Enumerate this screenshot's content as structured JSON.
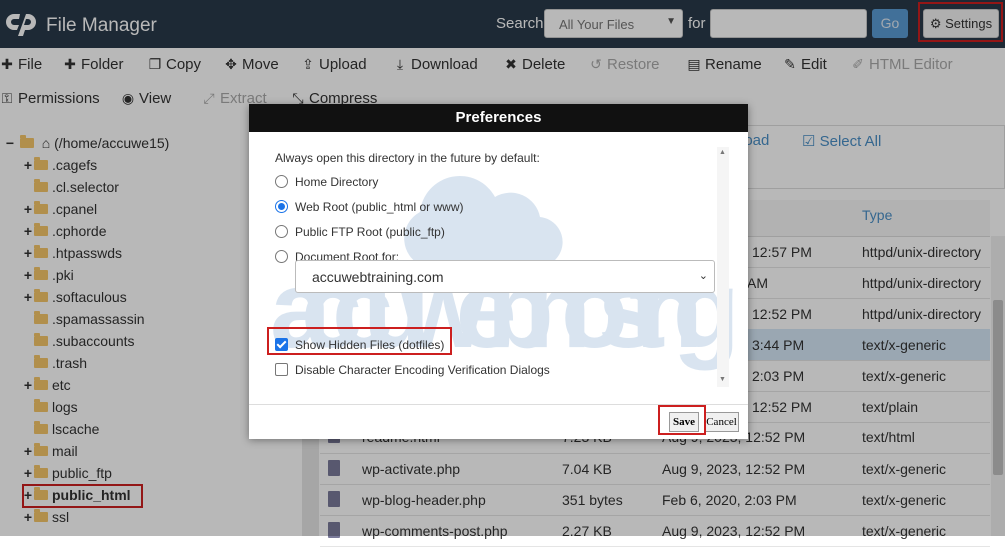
{
  "header": {
    "app_title": "File Manager",
    "search_label": "Search",
    "search_scope": "All Your Files",
    "for_label": "for",
    "search_value": "",
    "go_label": "Go",
    "settings_label": "Settings"
  },
  "toolbar": {
    "row1": [
      {
        "label": "File",
        "icon": "plus-icon",
        "disabled": false
      },
      {
        "label": "Folder",
        "icon": "plus-icon",
        "disabled": false
      },
      {
        "label": "Copy",
        "icon": "copy-icon",
        "disabled": false
      },
      {
        "label": "Move",
        "icon": "move-icon",
        "disabled": false
      },
      {
        "label": "Upload",
        "icon": "upload-icon",
        "disabled": false
      },
      {
        "label": "Download",
        "icon": "download-icon",
        "disabled": false
      },
      {
        "label": "Delete",
        "icon": "close-icon",
        "disabled": false
      },
      {
        "label": "Restore",
        "icon": "restore-icon",
        "disabled": true
      },
      {
        "label": "Rename",
        "icon": "document-icon",
        "disabled": false
      },
      {
        "label": "Edit",
        "icon": "pencil-icon",
        "disabled": false
      },
      {
        "label": "HTML Editor",
        "icon": "edit-square-icon",
        "disabled": true
      }
    ],
    "row2": [
      {
        "label": "Permissions",
        "icon": "key-icon",
        "disabled": false
      },
      {
        "label": "View",
        "icon": "eye-icon",
        "disabled": false
      },
      {
        "label": "Extract",
        "icon": "expand-icon",
        "disabled": true
      },
      {
        "label": "Compress",
        "icon": "compress-icon",
        "disabled": false
      }
    ]
  },
  "tree": {
    "root": "(/home/accuwe15)",
    "items": [
      {
        "label": ".cagefs",
        "expandable": true
      },
      {
        "label": ".cl.selector",
        "expandable": false
      },
      {
        "label": ".cpanel",
        "expandable": true
      },
      {
        "label": ".cphorde",
        "expandable": true
      },
      {
        "label": ".htpasswds",
        "expandable": true
      },
      {
        "label": ".pki",
        "expandable": true
      },
      {
        "label": ".softaculous",
        "expandable": true
      },
      {
        "label": ".spamassassin",
        "expandable": false
      },
      {
        "label": ".subaccounts",
        "expandable": false
      },
      {
        "label": ".trash",
        "expandable": false
      },
      {
        "label": "etc",
        "expandable": true
      },
      {
        "label": "logs",
        "expandable": false
      },
      {
        "label": "lscache",
        "expandable": false
      },
      {
        "label": "mail",
        "expandable": true
      },
      {
        "label": "public_ftp",
        "expandable": true
      },
      {
        "label": "public_html",
        "expandable": true,
        "bold": true
      },
      {
        "label": "ssl",
        "expandable": true
      }
    ]
  },
  "file_actions": {
    "upload_partial": "load",
    "select_all": "Select All"
  },
  "table": {
    "type_header": "Type",
    "rows": [
      {
        "name": "",
        "size": "",
        "date": "12:57 PM",
        "type": "httpd/unix-directory"
      },
      {
        "name": "",
        "size": "",
        "date": "AM",
        "type": "httpd/unix-directory"
      },
      {
        "name": "",
        "size": "",
        "date": "12:52 PM",
        "type": "httpd/unix-directory"
      },
      {
        "name": "",
        "size": "",
        "date": "3:44 PM",
        "type": "text/x-generic",
        "selected": true
      },
      {
        "name": "",
        "size": "",
        "date": "2:03 PM",
        "type": "text/x-generic"
      },
      {
        "name": "",
        "size": "",
        "date": "12:52 PM",
        "type": "text/plain"
      },
      {
        "name": "readme.html",
        "size": "7.23 KB",
        "date": "Aug 9, 2023, 12:52 PM",
        "type": "text/html"
      },
      {
        "name": "wp-activate.php",
        "size": "7.04 KB",
        "date": "Aug 9, 2023, 12:52 PM",
        "type": "text/x-generic"
      },
      {
        "name": "wp-blog-header.php",
        "size": "351 bytes",
        "date": "Feb 6, 2020, 2:03 PM",
        "type": "text/x-generic"
      },
      {
        "name": "wp-comments-post.php",
        "size": "2.27 KB",
        "date": "Aug 9, 2023, 12:52 PM",
        "type": "text/x-generic"
      }
    ]
  },
  "modal": {
    "title": "Preferences",
    "prompt": "Always open this directory in the future by default:",
    "options": [
      {
        "label": "Home Directory",
        "checked": false
      },
      {
        "label": "Web Root (public_html or www)",
        "checked": true
      },
      {
        "label": "Public FTP Root (public_ftp)",
        "checked": false
      },
      {
        "label": "Document Root for:",
        "checked": false
      }
    ],
    "docroot_domain": "accuwebtraining.com",
    "show_hidden_label": "Show Hidden Files (dotfiles)",
    "show_hidden_checked": true,
    "disable_encoding_label": "Disable Character Encoding Verification Dialogs",
    "disable_encoding_checked": false,
    "save_label": "Save",
    "cancel_label": "Cancel",
    "watermark_text": "accu web hosting"
  },
  "colors": {
    "topbar": "#293a4a",
    "accent": "#4a8fc7",
    "highlight_box": "#cc1f1f",
    "selected_row": "#d6e8f7"
  }
}
